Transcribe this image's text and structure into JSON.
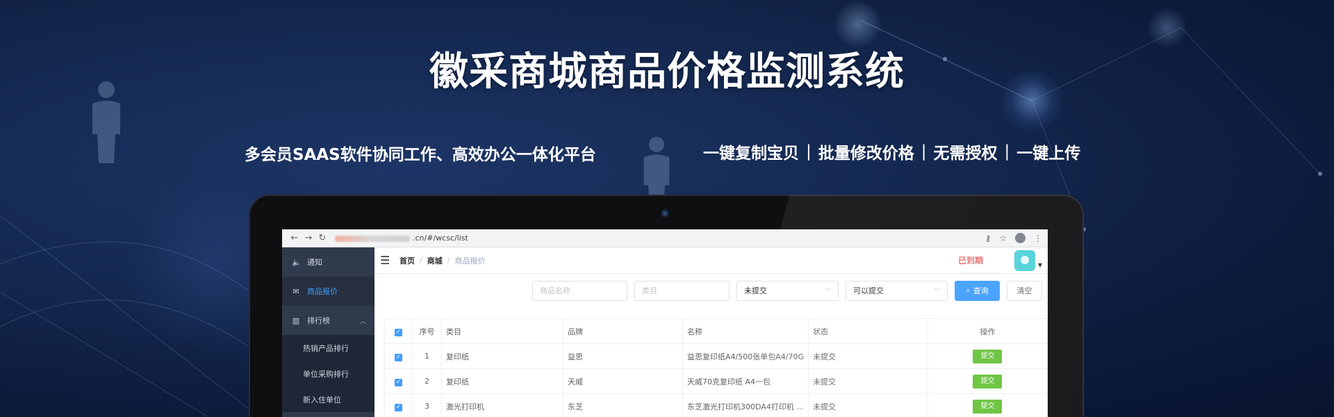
{
  "banner": {
    "headline": "徽采商城商品价格监测系统",
    "tagline_left": "多会员SAAS软件协同工作、高效办公一体化平台",
    "features": [
      "一键复制宝贝",
      "批量修改价格",
      "无需授权",
      "一键上传"
    ],
    "separator": "|"
  },
  "browser": {
    "back": "←",
    "forward": "→",
    "reload": "↻",
    "url_visible": ".cn/#/wcsc/list",
    "key_icon": "⚷",
    "star_icon": "☆",
    "menu_icon": "⋮"
  },
  "sidebar": {
    "items": [
      {
        "icon": "🔈",
        "label": "通知",
        "active": false
      },
      {
        "icon": "✉",
        "label": "商品报价",
        "active": true
      },
      {
        "icon": "▥",
        "label": "排行榜",
        "active": false,
        "chevron": "︿"
      }
    ],
    "sub_items": [
      "热销产品排行",
      "单位采购排行",
      "新入住单位"
    ]
  },
  "topbar": {
    "hamburger": "☰",
    "breadcrumb": [
      "首页",
      "商城",
      "商品报价"
    ],
    "crumb_sep": "/",
    "status": "已到期",
    "caret": "▼"
  },
  "filters": {
    "name_placeholder": "商品名称",
    "category_placeholder": "类目",
    "submit_status": "未提交",
    "can_submit": "可以提交",
    "chevron": "﹀",
    "query_icon": "⌕",
    "query_label": "查询",
    "clear_label": "清空"
  },
  "table": {
    "headers": [
      "序号",
      "类目",
      "品牌",
      "名称",
      "状态",
      "操作"
    ],
    "check_mark": "✓",
    "rows": [
      {
        "no": "1",
        "category": "复印纸",
        "brand": "益思",
        "name": "益思复印纸A4/500张单包A4/70G",
        "status": "未提交",
        "action": "提交"
      },
      {
        "no": "2",
        "category": "复印纸",
        "brand": "天威",
        "name": "天威70克复印纸 A4一包",
        "status": "未提交",
        "action": "提交"
      },
      {
        "no": "3",
        "category": "激光打印机",
        "brand": "东芝",
        "name": "东芝激光打印机300DA4打印机 ...",
        "status": "未提交",
        "action": "提交"
      }
    ]
  },
  "colors": {
    "accent": "#409eff",
    "success": "#67c23a",
    "danger": "#e02020",
    "sidebar_bg": "#2f3a4d"
  }
}
